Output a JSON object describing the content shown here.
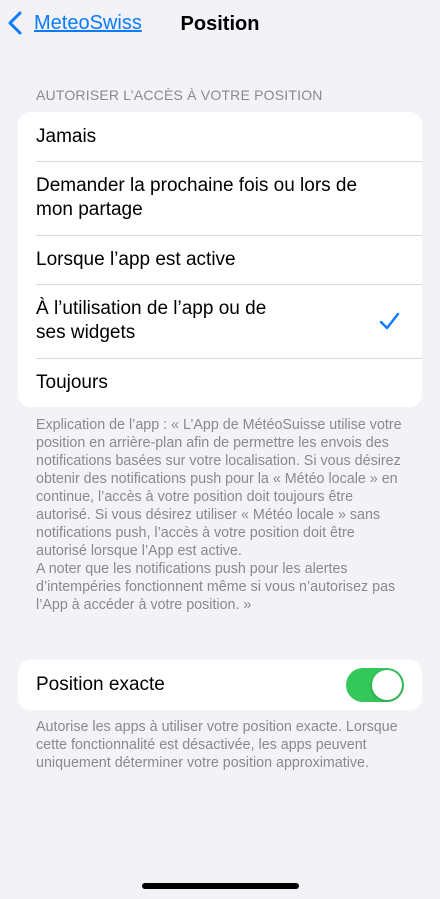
{
  "nav": {
    "back_label": "MeteoSwiss",
    "title": "Position"
  },
  "section_header": "AUTORISER L’ACCÈS À VOTRE POSITION",
  "options": [
    {
      "label": "Jamais",
      "selected": false
    },
    {
      "label": "Demander la prochaine fois ou lors de mon partage",
      "selected": false
    },
    {
      "label": "Lorsque l’app est active",
      "selected": false
    },
    {
      "label": "À l’utilisation de l’app ou de ses widgets",
      "selected": true
    },
    {
      "label": "Toujours",
      "selected": false
    }
  ],
  "app_explanation": {
    "paragraph_1": "Explication de l’app : « L’App de MétéoSuisse utilise votre position en arrière-plan afin de permettre les envois des notifications basées sur votre localisation. Si  vous désirez obtenir des notifications push pour la « Météo locale » en continue, l’accès à votre position doit toujours être autorisé. Si vous désirez utiliser « Météo locale » sans notifications push, l’accès à votre position doit être autorisé lorsque l’App est active.",
    "paragraph_2": "A noter que les notifications push pour les alertes d’intempéries fonctionnent même si vous n’autorisez pas l’App à accéder à votre position. »"
  },
  "precise_location": {
    "label": "Position exacte",
    "enabled": true,
    "footer": "Autorise les apps à utiliser votre position exacte. Lorsque cette fonctionnalité est désactivée, les apps peuvent uniquement déterminer votre position approximative."
  },
  "colors": {
    "accent": "#0a7aff",
    "toggle_on": "#34c759",
    "background": "#f2f2f7"
  }
}
